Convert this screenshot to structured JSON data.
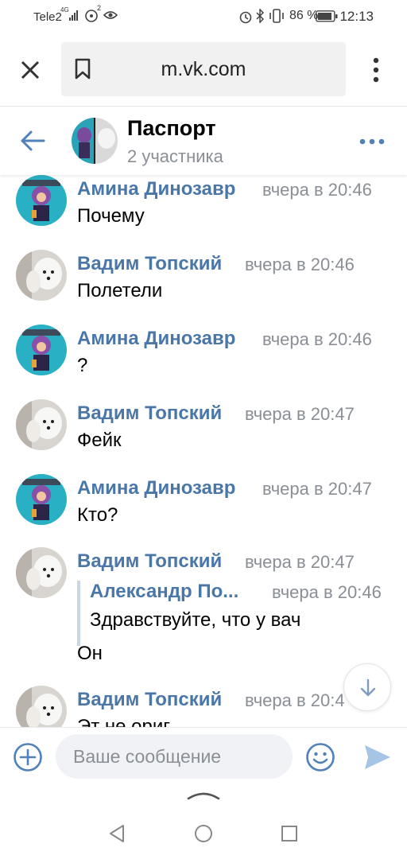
{
  "status_bar": {
    "carrier": "Tele2",
    "network": "4G",
    "time": "12:13",
    "battery": "86 %"
  },
  "browser": {
    "url": "m.vk.com"
  },
  "chat": {
    "title": "Паспорт",
    "subtitle": "2 участника"
  },
  "messages": [
    {
      "author": "Амина Динозавр",
      "time": "вчера в 20:46",
      "text": "Почему",
      "avatar": "amina"
    },
    {
      "author": "Вадим Топский",
      "time": "вчера в 20:46",
      "text": "Полетели",
      "avatar": "vadim"
    },
    {
      "author": "Амина Динозавр",
      "time": "вчера в 20:46",
      "text": "?",
      "avatar": "amina"
    },
    {
      "author": "Вадим Топский",
      "time": "вчера в 20:47",
      "text": "Фейк",
      "avatar": "vadim"
    },
    {
      "author": "Амина Динозавр",
      "time": "вчера в 20:47",
      "text": "Кто?",
      "avatar": "amina"
    },
    {
      "author": "Вадим Топский",
      "time": "вчера в 20:47",
      "text": "Он",
      "avatar": "vadim",
      "quote": {
        "author": "Александр По...",
        "time": "вчера в 20:46",
        "text": "Здравствуйте, что у вач"
      }
    },
    {
      "author": "Вадим Топский",
      "time": "вчера в 20:4",
      "text": "Эт не ориг",
      "avatar": "vadim"
    }
  ],
  "composer": {
    "placeholder": "Ваше сообщение"
  },
  "colors": {
    "accent": "#4a76a8",
    "muted": "#8a8f96",
    "icon_blue": "#5181b8",
    "send_blue": "#a6c4e4"
  },
  "icons": [
    "close-icon",
    "bookmark-icon",
    "more-vertical-icon",
    "back-arrow-icon",
    "more-horizontal-icon",
    "add-icon",
    "emoji-icon",
    "send-icon",
    "scroll-down-icon",
    "nav-back-icon",
    "nav-home-icon",
    "nav-recents-icon"
  ]
}
